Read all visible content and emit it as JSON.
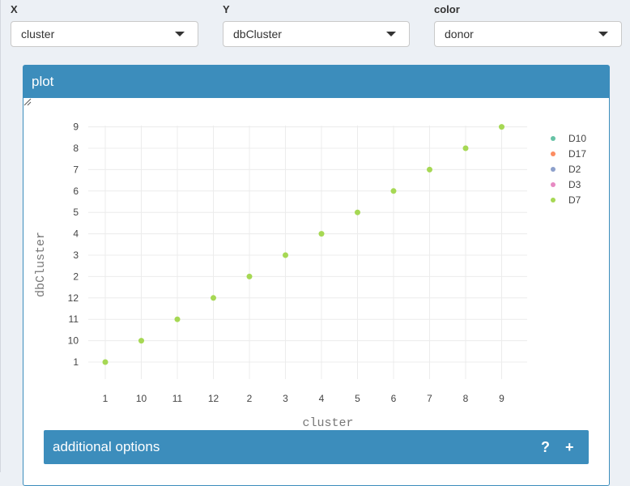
{
  "controls": {
    "x": {
      "label": "X",
      "value": "cluster"
    },
    "y": {
      "label": "Y",
      "value": "dbCluster"
    },
    "color": {
      "label": "color",
      "value": "donor"
    }
  },
  "panel": {
    "title": "plot"
  },
  "additional_options": {
    "title": "additional options",
    "help_label": "?",
    "expand_label": "+"
  },
  "colors": {
    "accent": "#3c8dbc",
    "D10": "#66c2a5",
    "D17": "#fc8d62",
    "D2": "#8da0cb",
    "D3": "#e78ac3",
    "D7": "#a6d854"
  },
  "chart_data": {
    "type": "scatter",
    "xlabel": "cluster",
    "ylabel": "dbCluster",
    "x_categories": [
      "1",
      "10",
      "11",
      "12",
      "2",
      "3",
      "4",
      "5",
      "6",
      "7",
      "8",
      "9"
    ],
    "y_categories": [
      "1",
      "10",
      "11",
      "12",
      "2",
      "3",
      "4",
      "5",
      "6",
      "7",
      "8",
      "9"
    ],
    "legend": [
      "D10",
      "D17",
      "D2",
      "D3",
      "D7"
    ],
    "legend_position": "right",
    "grid": true,
    "points": [
      {
        "x": "1",
        "y": "1",
        "donor": "D7"
      },
      {
        "x": "10",
        "y": "10",
        "donor": "D7"
      },
      {
        "x": "11",
        "y": "11",
        "donor": "D7"
      },
      {
        "x": "12",
        "y": "12",
        "donor": "D7"
      },
      {
        "x": "2",
        "y": "2",
        "donor": "D7"
      },
      {
        "x": "3",
        "y": "3",
        "donor": "D7"
      },
      {
        "x": "4",
        "y": "4",
        "donor": "D7"
      },
      {
        "x": "5",
        "y": "5",
        "donor": "D7"
      },
      {
        "x": "6",
        "y": "6",
        "donor": "D7"
      },
      {
        "x": "7",
        "y": "7",
        "donor": "D7"
      },
      {
        "x": "8",
        "y": "8",
        "donor": "D7"
      },
      {
        "x": "9",
        "y": "9",
        "donor": "D7"
      }
    ]
  }
}
